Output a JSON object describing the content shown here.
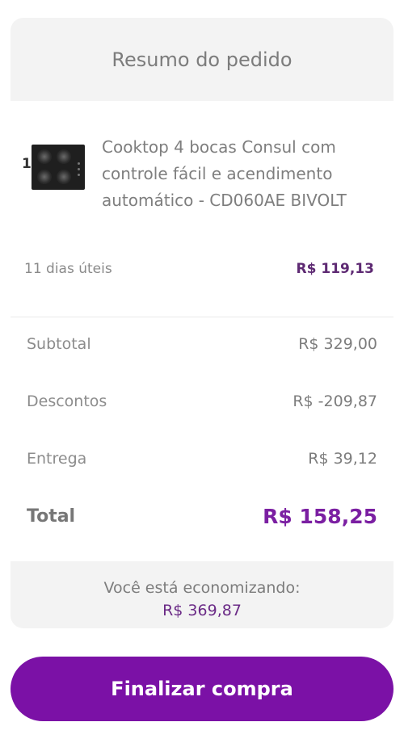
{
  "summary": {
    "title": "Resumo do pedido"
  },
  "item": {
    "quantity": "1",
    "name": "Cooktop 4 bocas Consul com controle fácil e acendimento automático - CD060AE BIVOLT",
    "image_icon": "cooktop-product-image",
    "delivery_time": "11 dias úteis",
    "shipping_price": "R$ 119,13"
  },
  "totals": {
    "subtotal_label": "Subtotal",
    "subtotal_value": "R$ 329,00",
    "discounts_label": "Descontos",
    "discounts_value": "R$ -209,87",
    "delivery_label": "Entrega",
    "delivery_value": "R$ 39,12",
    "total_label": "Total",
    "total_value": "R$ 158,25"
  },
  "savings": {
    "label": "Você está economizando:",
    "value": "R$ 369,87"
  },
  "checkout": {
    "button_label": "Finalizar compra"
  },
  "colors": {
    "accent": "#7b11a6",
    "total": "#7b1fa2",
    "panel_bg": "#f3f3f3"
  }
}
